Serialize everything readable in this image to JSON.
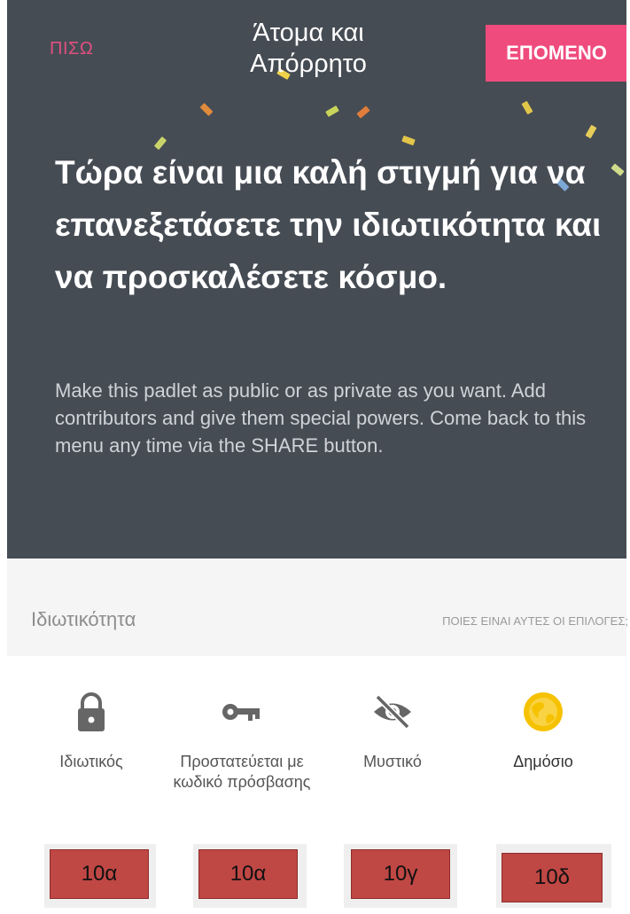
{
  "header": {
    "back_label": "ΠΙΣΩ",
    "title": "Άτομα και Απόρρητο",
    "next_label": "ΕΠΟΜΕΝΟ"
  },
  "intro": {
    "headline": "Τώρα είναι μια καλή στιγμή για να επανεξετάσετε την ιδιωτικότητα και να προσκαλέσετε κόσμο.",
    "description": "Make this padlet as public or as private as you want. Add contributors and give them special powers. Come back to this menu any time via the SHARE button."
  },
  "privacy": {
    "label": "Ιδιωτικότητα",
    "help_link": "ΠΟΙΕΣ ΕΙΝΑΙ ΑΥΤΕΣ ΟΙ ΕΠΙΛΟΓΕΣ;",
    "options": [
      {
        "label": "Ιδιωτικός",
        "icon": "lock-icon",
        "color": "#666666"
      },
      {
        "label": "Προστατεύεται με κωδικό πρόσβασης",
        "icon": "key-icon",
        "color": "#666666"
      },
      {
        "label": "Μυστικό",
        "icon": "eye-slash-icon",
        "color": "#666666"
      },
      {
        "label": "Δημόσιο",
        "icon": "globe-icon",
        "color": "#f6c200"
      }
    ]
  },
  "tags": [
    "10α",
    "10α",
    "10γ",
    "10δ"
  ],
  "colors": {
    "header_bg": "#464c54",
    "accent": "#ef4b7d",
    "tag_bg": "#bf4744",
    "public_yellow": "#f6c200"
  }
}
